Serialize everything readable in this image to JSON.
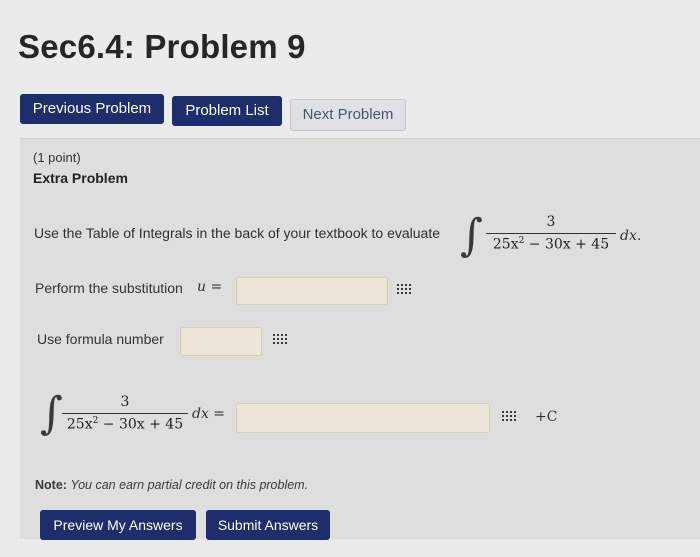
{
  "header": {
    "title": "Sec6.4: Problem 9"
  },
  "nav": {
    "previous_label": "Previous Problem",
    "list_label": "Problem List",
    "next_label": "Next Problem"
  },
  "problem": {
    "points": "(1 point)",
    "heading": "Extra Problem",
    "instruction": "Use the Table of Integrals in the back of your textbook to evaluate",
    "integral": {
      "numerator": "3",
      "den_a": "25x",
      "den_exp": "2",
      "den_rest": "− 30x + 45",
      "differential": "dx."
    }
  },
  "answers": {
    "substitution_label": "Perform the substitution",
    "substitution_var": "u =",
    "formula_label": "Use formula number",
    "final_numerator": "3",
    "final_den_a": "25x",
    "final_den_exp": "2",
    "final_den_rest": "− 30x + 45",
    "final_differential": "dx =",
    "constant": "+C"
  },
  "note": {
    "label": "Note:",
    "text": "You can earn partial credit on this problem."
  },
  "actions": {
    "preview_label": "Preview My Answers",
    "submit_label": "Submit Answers"
  },
  "icons": {
    "equation_editor": "grid-keypad-icon"
  },
  "colors": {
    "button_primary": "#1e2e6c",
    "button_secondary": "#dfe1e6",
    "field_bg": "#ebe6d8"
  }
}
